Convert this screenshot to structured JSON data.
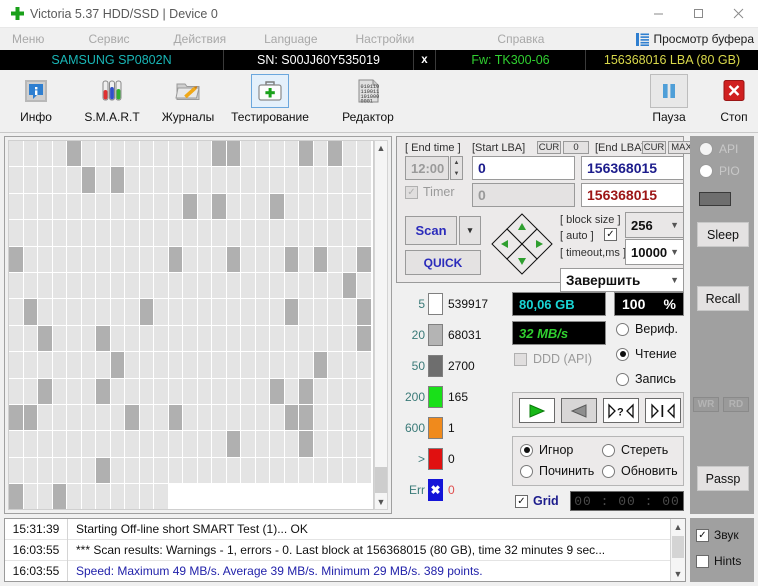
{
  "window": {
    "title": "Victoria 5.37 HDD/SSD | Device 0",
    "app_icon": "green-cross-icon",
    "minimize": "—",
    "maximize": "□",
    "close": "✕"
  },
  "menubar": {
    "items": [
      "Меню",
      "Сервис",
      "Действия",
      "Language",
      "Настройки",
      "Справка"
    ],
    "buffer_view": "Просмотр буфера"
  },
  "drive": {
    "model": "SAMSUNG SP0802N",
    "serial": "SN: S00JJ60Y535019",
    "x": "x",
    "firmware": "Fw: TK300-06",
    "capacity": "156368016 LBA (80 GB)",
    "model_color": "#19b6b6",
    "fw_color": "#30d030",
    "lba_color": "#d8d84a"
  },
  "toolbar": {
    "buttons": [
      {
        "label": "Инфо",
        "icon": "info-icon",
        "selected": false
      },
      {
        "label": "S.M.A.R.T",
        "icon": "test-tubes-icon",
        "selected": false
      },
      {
        "label": "Журналы",
        "icon": "folder-pencil-icon",
        "selected": false
      },
      {
        "label": "Тестирование",
        "icon": "first-aid-kit-icon",
        "selected": true
      },
      {
        "label": "Редактор",
        "icon": "hex-editor-icon",
        "selected": false
      },
      {
        "label": "Пауза",
        "icon": "pause-icon",
        "selected": false
      },
      {
        "label": "Стоп",
        "icon": "stop-x-icon",
        "selected": false
      }
    ]
  },
  "scan_params": {
    "end_time_label": "[ End time ]",
    "end_time_value": "12:00",
    "timer_label": "Timer",
    "timer_checked": true,
    "start_lba_label": "[Start LBA]",
    "start_lba_cur": "CUR",
    "start_lba_zero": "0",
    "start_lba_value": "0",
    "start_lba_value2": "0",
    "end_lba_label": "[End LBA]",
    "end_lba_cur": "CUR",
    "end_lba_max": "MAX",
    "end_lba_value": "156368015",
    "end_lba_value2": "156368015",
    "scan_button": "Scan",
    "quick_button": "QUICK",
    "dropdown_arrow": "▾",
    "block_size_label": "[ block size ]",
    "auto_label": "[ auto ]",
    "auto_checked": true,
    "block_size_value": "256",
    "timeout_label": "[ timeout,ms ]",
    "timeout_value": "10000",
    "finish_action": "Завершить",
    "dpad": {
      "up": "▲",
      "down": "▼",
      "left": "◀",
      "right": "▶"
    }
  },
  "legend": {
    "rows": [
      {
        "threshold": "5",
        "color": "#ffffff",
        "count": "539917"
      },
      {
        "threshold": "20",
        "color": "#b4b4b4",
        "count": "68031"
      },
      {
        "threshold": "50",
        "color": "#6e6e6e",
        "count": "2700"
      },
      {
        "threshold": "200",
        "color": "#19e019",
        "count": "165"
      },
      {
        "threshold": "600",
        "color": "#f08a1c",
        "count": "1"
      },
      {
        "threshold": ">",
        "color": "#e01010",
        "count": "0"
      },
      {
        "threshold": "Err",
        "color": "#1414d8",
        "count": "0",
        "mark": "✖"
      }
    ]
  },
  "stats": {
    "size_value": "80,06 GB",
    "size_color": "#19d6d6",
    "percent_value": "100",
    "percent_unit": "%",
    "speed_value": "32 MB/s",
    "speed_color": "#30d030",
    "ddd_label": "DDD (API)",
    "ddd_checked": false,
    "modes": [
      {
        "label": "Вериф.",
        "selected": false
      },
      {
        "label": "Чтение",
        "selected": true
      },
      {
        "label": "Запись",
        "selected": false
      }
    ],
    "transport": [
      {
        "name": "play-forward-button",
        "glyph": "▶",
        "color": "#18b818"
      },
      {
        "name": "play-backward-button",
        "glyph": "◀",
        "color": "#777777"
      },
      {
        "name": "random-scan-button",
        "glyph": "⫺?⫻",
        "color": "#202020"
      },
      {
        "name": "butterfly-scan-button",
        "glyph": "⫺|⫻",
        "color": "#202020"
      }
    ],
    "defect_actions": [
      {
        "label": "Игнор",
        "selected": true
      },
      {
        "label": "Стереть",
        "selected": false
      },
      {
        "label": "Починить",
        "selected": false
      },
      {
        "label": "Обновить",
        "selected": false
      }
    ],
    "grid_label": "Grid",
    "grid_checked": true,
    "elapsed": "00 : 00 : 00"
  },
  "right_column": {
    "api_label": "API",
    "pio_label": "PIO",
    "sleep_label": "Sleep",
    "recall_label": "Recall",
    "wr_label": "WR",
    "rd_label": "RD",
    "passp_label": "Passp"
  },
  "log": {
    "rows": [
      {
        "time": "15:31:39",
        "message": "Starting Off-line short SMART Test (1)... OK",
        "highlight": false
      },
      {
        "time": "16:03:55",
        "message": "*** Scan results: Warnings - 1, errors - 0. Last block at 156368015 (80 GB), time 32 minutes 9 sec...",
        "highlight": false
      },
      {
        "time": "16:03:55",
        "message": "Speed: Maximum 49 MB/s. Average 39 MB/s. Minimum 29 MB/s. 389 points.",
        "highlight": true
      }
    ]
  },
  "footer": {
    "sound_label": "Звук",
    "sound_checked": true,
    "hints_label": "Hints",
    "hints_checked": false
  },
  "map": {
    "total_cells": 350,
    "filled_cells": 336,
    "light_color": "#e4e4e4",
    "dark_color": "#b0b0b0",
    "empty_color": "#ffffff"
  }
}
